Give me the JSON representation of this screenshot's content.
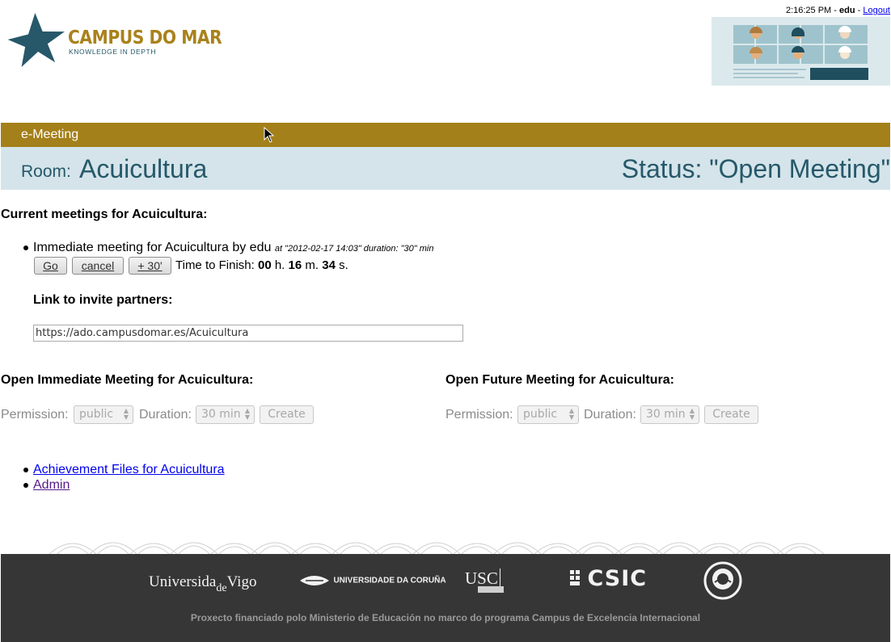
{
  "brand": {
    "name": "CAMPUS DO MAR",
    "tagline": "KNOWLEDGE IN DEPTH",
    "color_gold": "#a4801a",
    "color_teal": "#26586a"
  },
  "user_bar": {
    "time": "2:16:25 PM",
    "sep1": " - ",
    "username": "edu",
    "sep2": " - ",
    "logout": "Logout"
  },
  "section_bar": {
    "title": "e-Meeting"
  },
  "room_bar": {
    "room_label": "Room:",
    "room_name": "Acuicultura",
    "status": "Status: \"Open Meeting\""
  },
  "current": {
    "heading": "Current meetings for Acuicultura:",
    "meeting_title": "Immediate meeting for Acuicultura by edu",
    "meeting_meta": "at \"2012-02-17 14:03\" duration: \"30\" min",
    "buttons": {
      "go": "Go",
      "cancel": "cancel",
      "extend": "+ 30'"
    },
    "time_to_finish": {
      "label": "Time to Finish:",
      "hours": "00",
      "h": "h.",
      "minutes": "16",
      "m": "m.",
      "seconds": "34",
      "s": "s."
    },
    "invite_heading": "Link to invite partners:",
    "invite_url": "https://ado.campusdomar.es/Acuicultura"
  },
  "open_immediate": {
    "heading": "Open Immediate Meeting for Acuicultura:",
    "permission_label": "Permission:",
    "permission_value": "public",
    "duration_label": "Duration:",
    "duration_value": "30 min",
    "create": "Create"
  },
  "open_future": {
    "heading": "Open Future Meeting for Acuicultura:",
    "permission_label": "Permission:",
    "permission_value": "public",
    "duration_label": "Duration:",
    "duration_value": "30 min",
    "create": "Create"
  },
  "links": [
    {
      "label": "Achievement Files for Acuicultura"
    },
    {
      "label": "Admin"
    }
  ],
  "footer": {
    "logos": {
      "uvigo": "Universida",
      "uvigo_de": "de",
      "uvigo_end": "Vigo",
      "udc": "UNIVERSIDADE DA CORUÑA",
      "usc": "USC",
      "csic": "CSIC"
    },
    "note": "Proxecto financiado polo Ministerio de Educación no marco do programa Campus de Excelencia Internacional"
  }
}
